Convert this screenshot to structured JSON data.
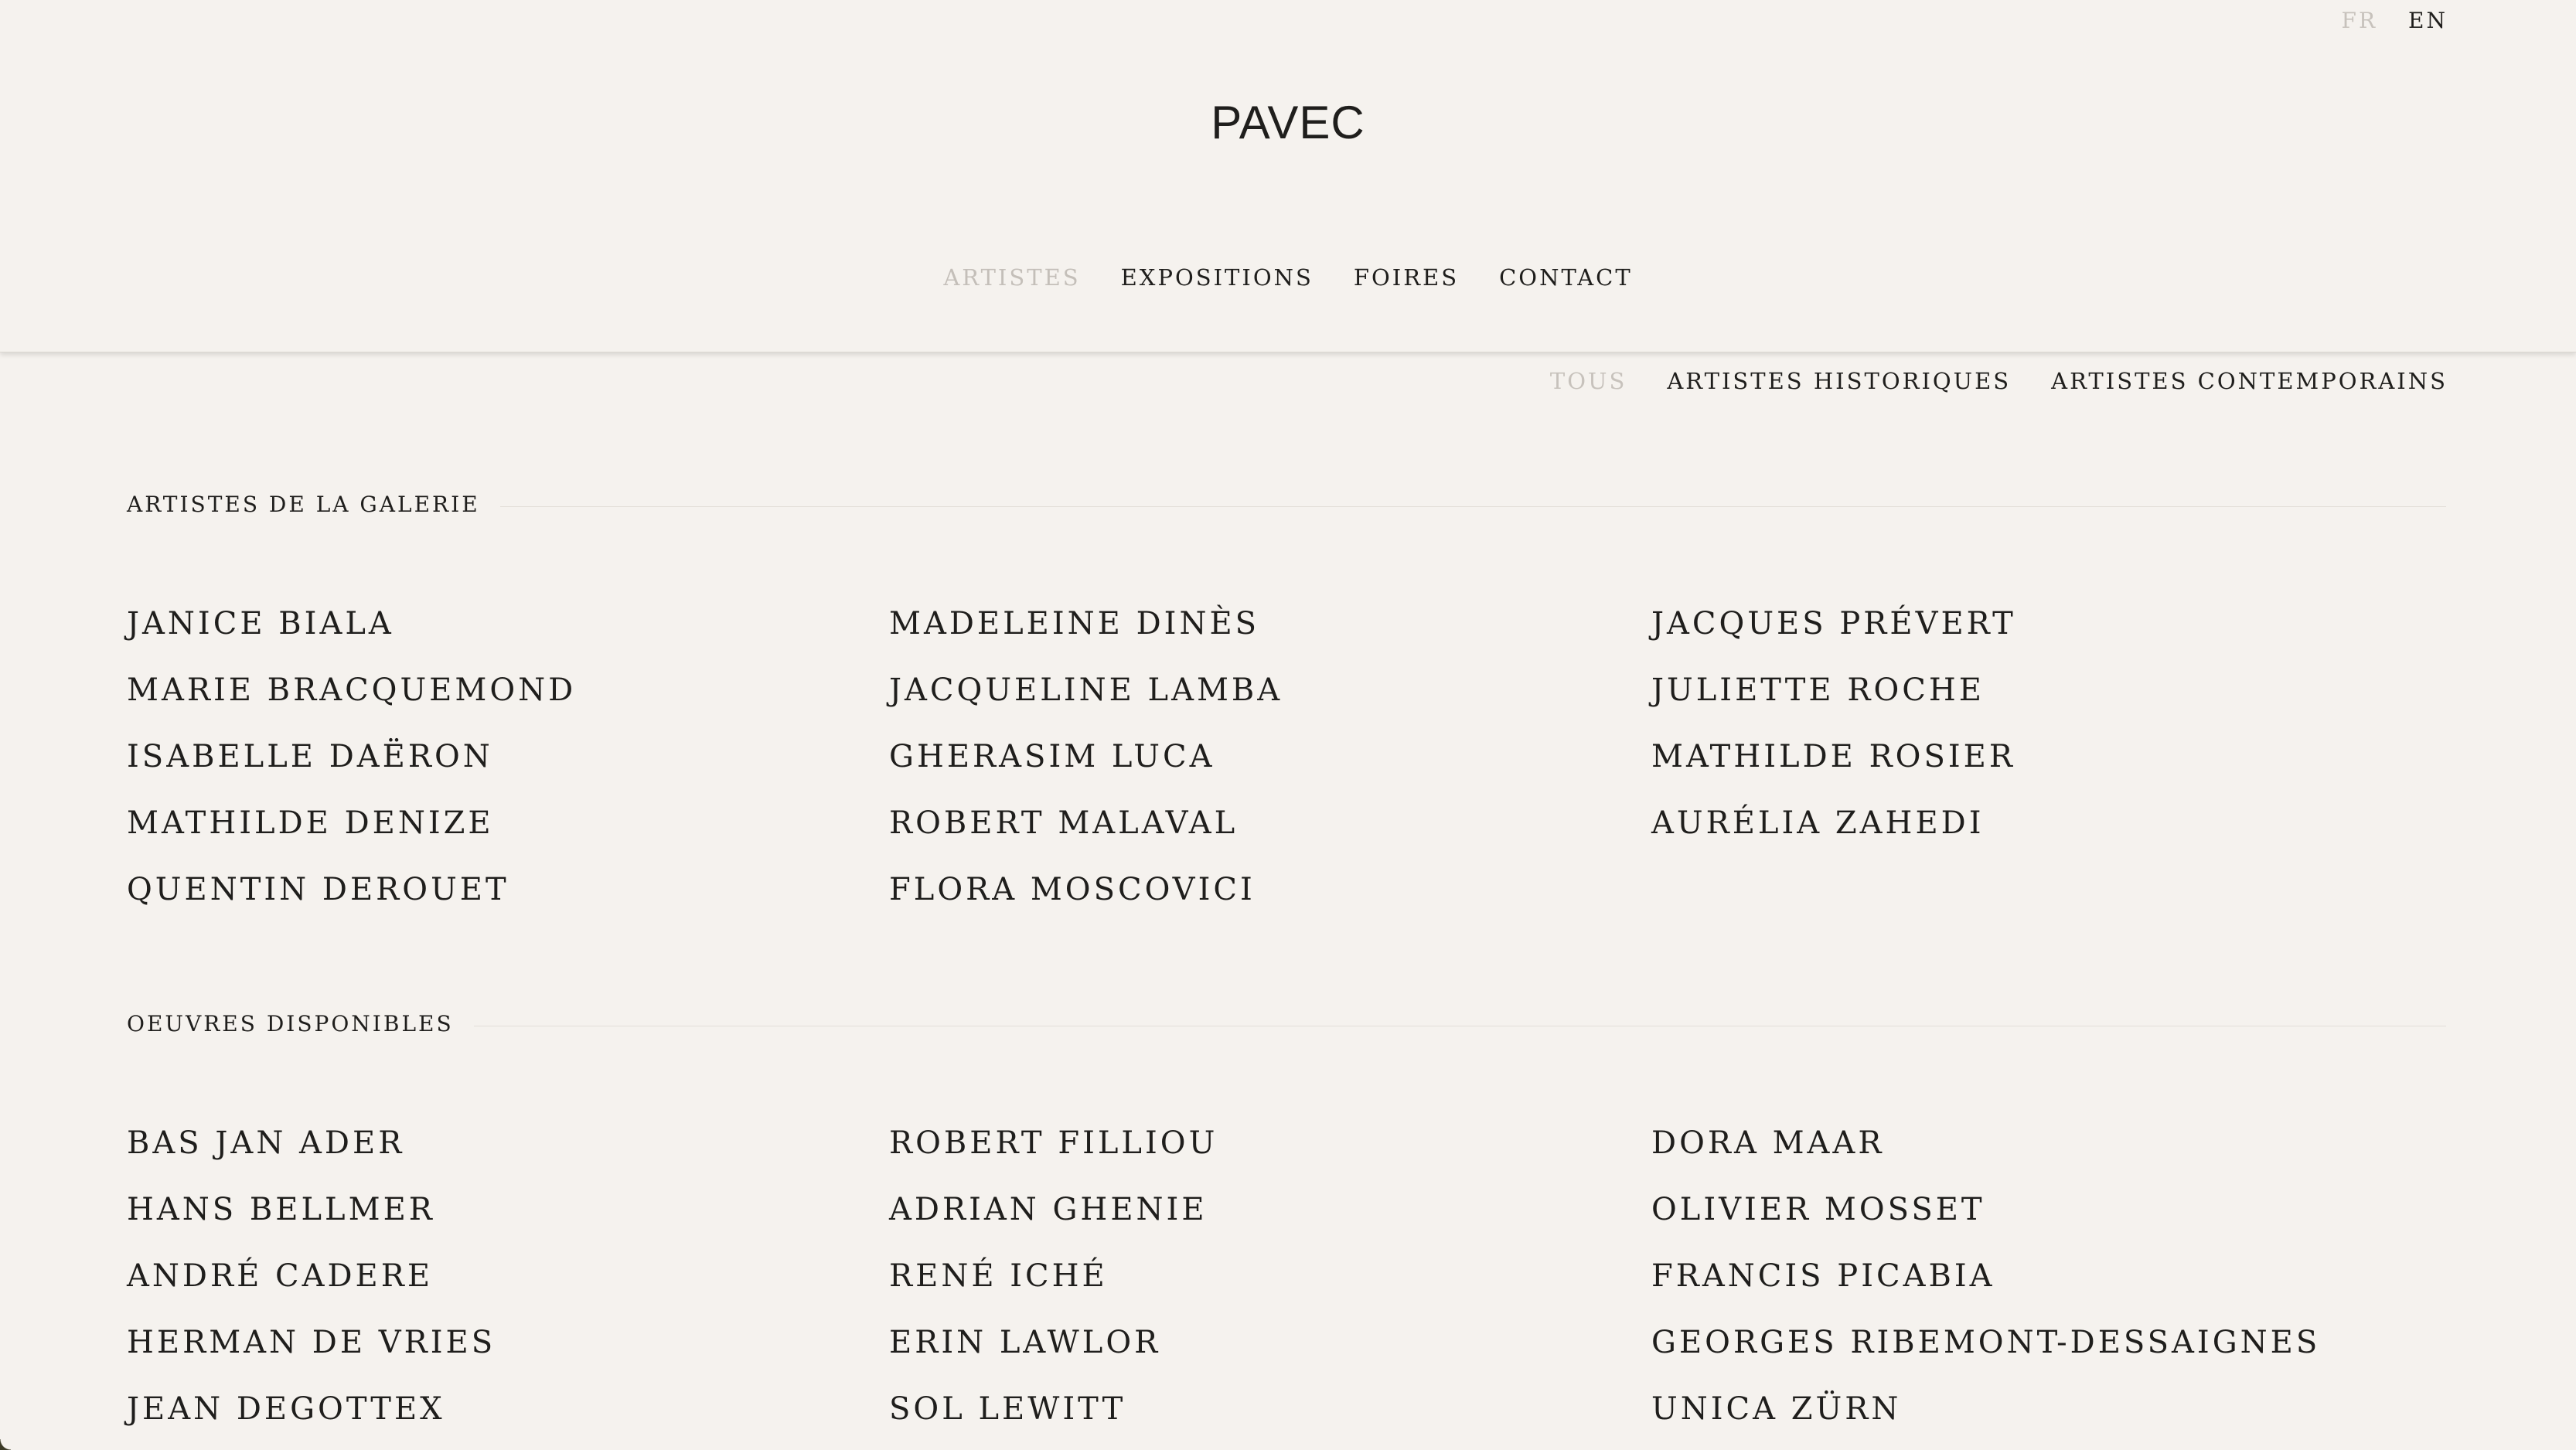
{
  "header": {
    "logo": "PAVEC",
    "languages": [
      {
        "label": "FR",
        "active": true
      },
      {
        "label": "EN",
        "active": false
      }
    ],
    "nav": [
      {
        "label": "ARTISTES",
        "active": true
      },
      {
        "label": "EXPOSITIONS",
        "active": false
      },
      {
        "label": "FOIRES",
        "active": false
      },
      {
        "label": "CONTACT",
        "active": false
      }
    ]
  },
  "filters": [
    {
      "label": "TOUS",
      "active": true
    },
    {
      "label": "ARTISTES HISTORIQUES",
      "active": false
    },
    {
      "label": "ARTISTES CONTEMPORAINS",
      "active": false
    }
  ],
  "sections": [
    {
      "title": "ARTISTES DE LA GALERIE",
      "columns": [
        [
          "JANICE BIALA",
          "MARIE BRACQUEMOND",
          "ISABELLE DAËRON",
          "MATHILDE DENIZE",
          "QUENTIN DEROUET"
        ],
        [
          "MADELEINE DINÈS",
          "JACQUELINE LAMBA",
          "GHERASIM LUCA",
          "ROBERT MALAVAL",
          "FLORA MOSCOVICI"
        ],
        [
          "JACQUES PRÉVERT",
          "JULIETTE ROCHE",
          "MATHILDE ROSIER",
          "AURÉLIA ZAHEDI"
        ]
      ]
    },
    {
      "title": "OEUVRES DISPONIBLES",
      "columns": [
        [
          "BAS JAN ADER",
          "HANS BELLMER",
          "ANDRÉ CADERE",
          "HERMAN DE VRIES",
          "JEAN DEGOTTEX"
        ],
        [
          "ROBERT FILLIOU",
          "ADRIAN GHENIE",
          "RENÉ ICHÉ",
          "ERIN LAWLOR",
          "SOL LEWITT"
        ],
        [
          "DORA MAAR",
          "OLIVIER MOSSET",
          "FRANCIS PICABIA",
          "GEORGES RIBEMONT-DESSAIGNES",
          "UNICA ZÜRN"
        ]
      ]
    }
  ],
  "colors": {
    "background": "#f5f2ee",
    "text": "#1f1e1c",
    "muted": "#c7c2bc"
  }
}
